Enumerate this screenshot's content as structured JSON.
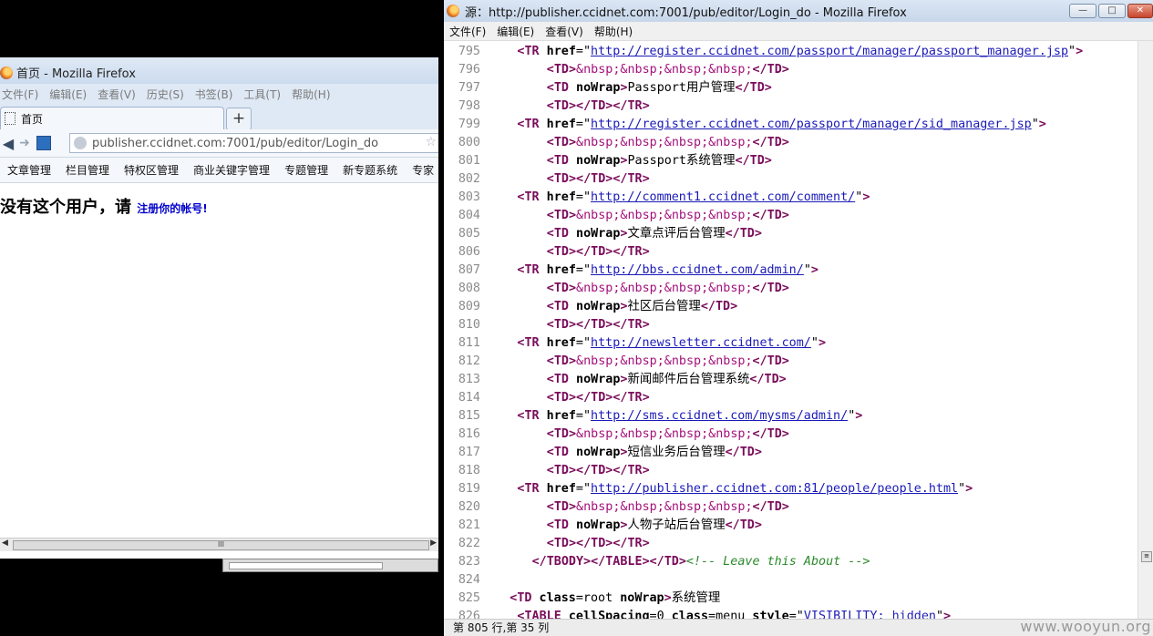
{
  "left_window": {
    "title": "首页 - Mozilla Firefox",
    "menu": [
      "文件(F)",
      "编辑(E)",
      "查看(V)",
      "历史(S)",
      "书签(B)",
      "工具(T)",
      "帮助(H)"
    ],
    "tab_label": "首页",
    "newtab_glyph": "+",
    "url": "publisher.ccidnet.com:7001/pub/editor/Login_do",
    "bookmarks": [
      "文章管理",
      "栏目管理",
      "特权区管理",
      "商业关键字管理",
      "专题管理",
      "新专题系统",
      "专家"
    ],
    "message_text": "没有这个用户，请",
    "message_link": "注册你的帐号!",
    "scroll_grip": "III"
  },
  "right_window": {
    "title": "源：http://publisher.ccidnet.com:7001/pub/editor/Login_do - Mozilla Firefox",
    "menu": [
      "文件(F)",
      "编辑(E)",
      "查看(V)",
      "帮助(H)"
    ],
    "status": "第 805 行,第 35 列",
    "code_lines": [
      {
        "n": "795",
        "indent": 4,
        "type": "tr",
        "href": "http://register.ccidnet.com/passport/manager/passport_manager.jsp"
      },
      {
        "n": "796",
        "indent": 8,
        "type": "nbsp"
      },
      {
        "n": "797",
        "indent": 8,
        "type": "nowrap",
        "text": "Passport用户管理"
      },
      {
        "n": "798",
        "indent": 8,
        "type": "empty"
      },
      {
        "n": "799",
        "indent": 4,
        "type": "tr",
        "href": "http://register.ccidnet.com/passport/manager/sid_manager.jsp"
      },
      {
        "n": "800",
        "indent": 8,
        "type": "nbsp"
      },
      {
        "n": "801",
        "indent": 8,
        "type": "nowrap",
        "text": "Passport系统管理"
      },
      {
        "n": "802",
        "indent": 8,
        "type": "empty"
      },
      {
        "n": "803",
        "indent": 4,
        "type": "tr",
        "href": "http://comment1.ccidnet.com/comment/"
      },
      {
        "n": "804",
        "indent": 8,
        "type": "nbsp"
      },
      {
        "n": "805",
        "indent": 8,
        "type": "nowrap",
        "text": "文章点评后台管理"
      },
      {
        "n": "806",
        "indent": 8,
        "type": "empty"
      },
      {
        "n": "807",
        "indent": 4,
        "type": "tr",
        "href": "http://bbs.ccidnet.com/admin/"
      },
      {
        "n": "808",
        "indent": 8,
        "type": "nbsp"
      },
      {
        "n": "809",
        "indent": 8,
        "type": "nowrap",
        "text": "社区后台管理"
      },
      {
        "n": "810",
        "indent": 8,
        "type": "empty"
      },
      {
        "n": "811",
        "indent": 4,
        "type": "tr",
        "href": "http://newsletter.ccidnet.com/"
      },
      {
        "n": "812",
        "indent": 8,
        "type": "nbsp"
      },
      {
        "n": "813",
        "indent": 8,
        "type": "nowrap",
        "text": "新闻邮件后台管理系统"
      },
      {
        "n": "814",
        "indent": 8,
        "type": "empty"
      },
      {
        "n": "815",
        "indent": 4,
        "type": "tr",
        "href": "http://sms.ccidnet.com/mysms/admin/"
      },
      {
        "n": "816",
        "indent": 8,
        "type": "nbsp"
      },
      {
        "n": "817",
        "indent": 8,
        "type": "nowrap",
        "text": "短信业务后台管理"
      },
      {
        "n": "818",
        "indent": 8,
        "type": "empty"
      },
      {
        "n": "819",
        "indent": 4,
        "type": "tr",
        "href": "http://publisher.ccidnet.com:81/people/people.html"
      },
      {
        "n": "820",
        "indent": 8,
        "type": "nbsp"
      },
      {
        "n": "821",
        "indent": 8,
        "type": "nowrap",
        "text": "人物子站后台管理"
      },
      {
        "n": "822",
        "indent": 8,
        "type": "empty"
      },
      {
        "n": "823",
        "indent": 6,
        "type": "close",
        "comment": "<!-- Leave this About -->"
      },
      {
        "n": "824",
        "indent": 0,
        "type": "blank"
      },
      {
        "n": "825",
        "indent": 3,
        "type": "tdroot",
        "text": "系统管理"
      },
      {
        "n": "826",
        "indent": 4,
        "type": "table"
      }
    ]
  },
  "watermark": "www.wooyun.org",
  "colors": {
    "tag": "#7a0c5a",
    "entity": "#a3127a",
    "link": "#1a1ab8",
    "comment": "#2a8a2a",
    "linenum": "#8c8c8c"
  }
}
